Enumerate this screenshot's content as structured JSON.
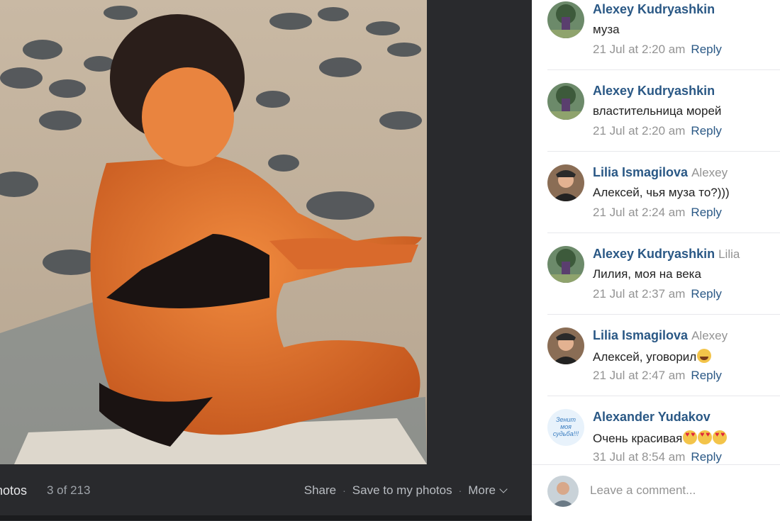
{
  "viewer": {
    "album_label": "hotos",
    "counter": "3 of 213",
    "actions": {
      "share": "Share",
      "save": "Save to my photos",
      "more": "More"
    }
  },
  "comments": [
    {
      "author": "Alexey Kudryashkin",
      "reply_to": "",
      "text": "муза",
      "time": "21 Jul at 2:20 am",
      "reply": "Reply",
      "avatar": "avatar-alexey",
      "emoji": []
    },
    {
      "author": "Alexey Kudryashkin",
      "reply_to": "",
      "text": "властительница морей",
      "time": "21 Jul at 2:20 am",
      "reply": "Reply",
      "avatar": "avatar-alexey",
      "emoji": []
    },
    {
      "author": "Lilia Ismagilova",
      "reply_to": "Alexey",
      "text": "Алексей, чья муза то?)))",
      "time": "21 Jul at 2:24 am",
      "reply": "Reply",
      "avatar": "avatar-lilia",
      "emoji": []
    },
    {
      "author": "Alexey Kudryashkin",
      "reply_to": "Lilia",
      "text": "Лилия, моя на века",
      "time": "21 Jul at 2:37 am",
      "reply": "Reply",
      "avatar": "avatar-alexey",
      "emoji": []
    },
    {
      "author": "Lilia Ismagilova",
      "reply_to": "Alexey",
      "text": "Алексей, уговорил",
      "time": "21 Jul at 2:47 am",
      "reply": "Reply",
      "avatar": "avatar-lilia",
      "emoji": [
        "grin"
      ]
    },
    {
      "author": "Alexander Yudakov",
      "reply_to": "",
      "text": "Очень красивая",
      "time": "31 Jul at 8:54 am",
      "reply": "Reply",
      "avatar": "avatar-alexander",
      "emoji": [
        "heart-eyes",
        "heart-eyes",
        "heart-eyes"
      ]
    }
  ],
  "avatar_alexander_text": "Зенит моя судьба!!!",
  "composer": {
    "placeholder": "Leave a comment..."
  },
  "colors": {
    "link": "#2a5885",
    "meta": "#939393",
    "viewer_bg": "#292a2d"
  }
}
